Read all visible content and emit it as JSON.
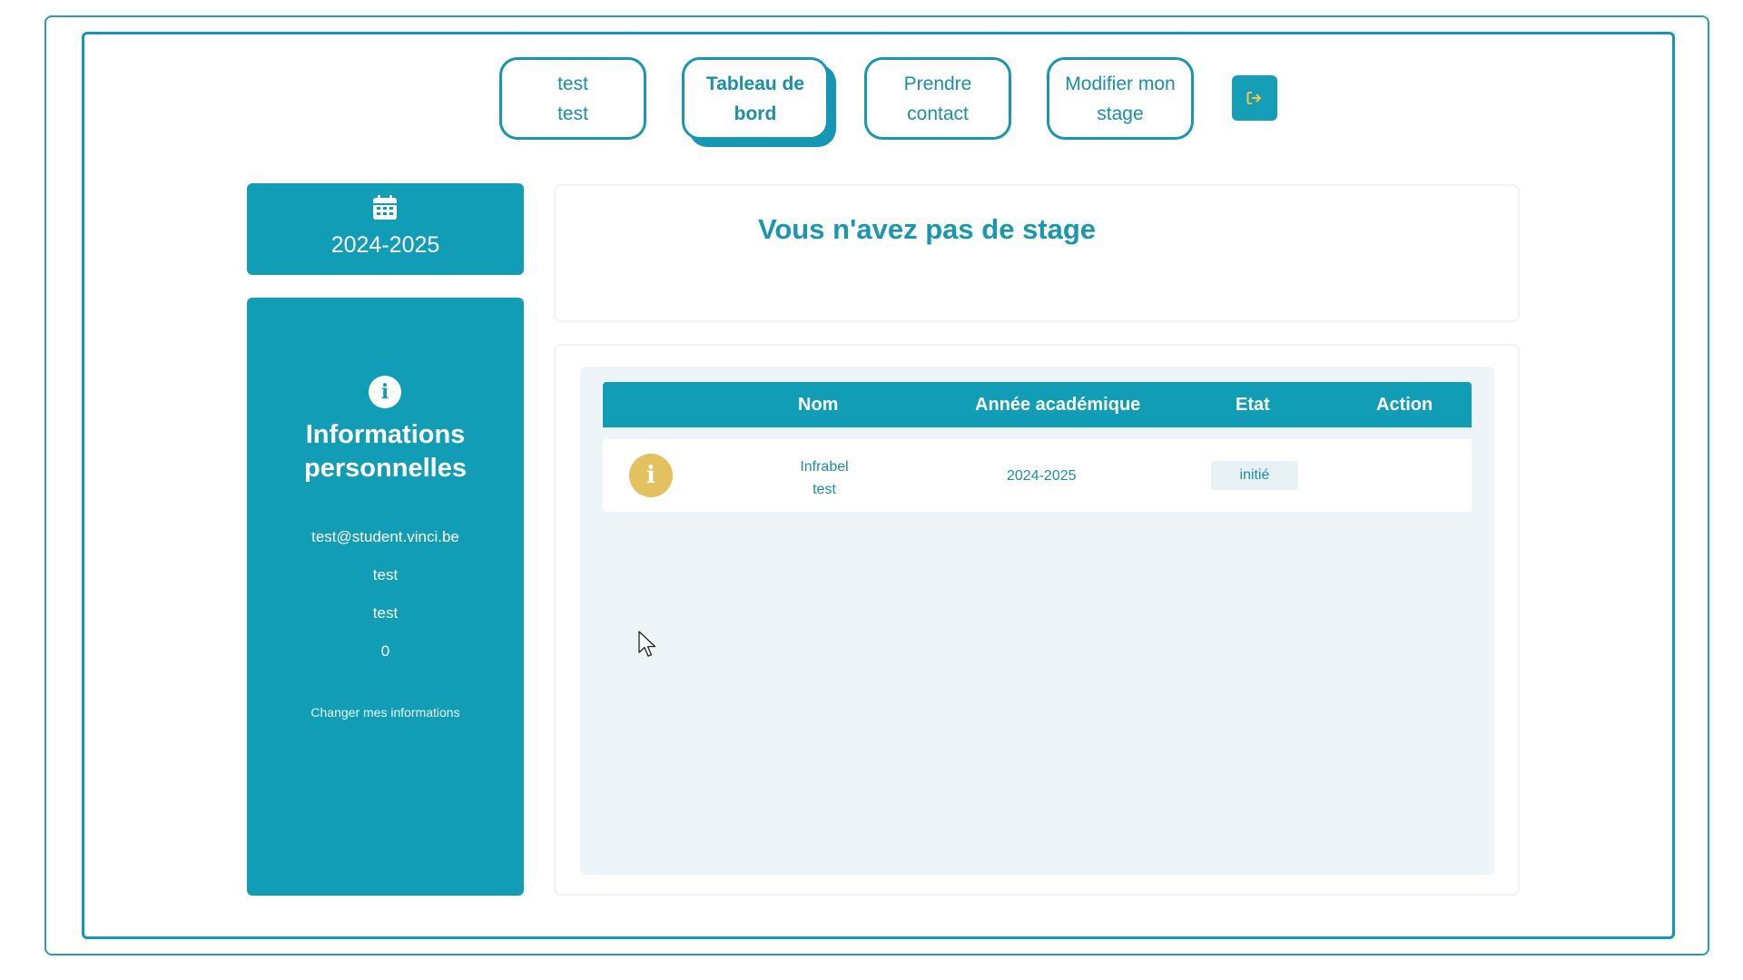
{
  "nav": {
    "profile": {
      "line1": "test",
      "line2": "test"
    },
    "dashboard": {
      "line1": "Tableau de",
      "line2": "bord"
    },
    "contact": {
      "line1": "Prendre",
      "line2": "contact"
    },
    "edit_internship": {
      "line1": "Modifier mon",
      "line2": "stage"
    },
    "logout_icon": "sign-out-icon",
    "active": "dashboard"
  },
  "sidebar": {
    "year_card": {
      "icon": "calendar-icon",
      "year": "2024-2025"
    },
    "info_card": {
      "icon": "info-icon",
      "title_line1": "Informations",
      "title_line2": "personnelles",
      "email": "test@student.vinci.be",
      "last_name": "test",
      "first_name": "test",
      "phone": "0",
      "change_link": "Changer mes informations"
    }
  },
  "main": {
    "status_message": "Vous n'avez pas de stage",
    "table": {
      "headers": [
        "Nom",
        "Année académique",
        "Etat",
        "Action"
      ],
      "rows": [
        {
          "icon": "info-icon",
          "name_line1": "Infrabel",
          "name_line2": "test",
          "academic_year": "2024-2025",
          "state": "initié",
          "action": ""
        }
      ]
    }
  },
  "colors": {
    "primary": "#129db7",
    "accent": "#e3c15f",
    "panel_bg": "#edf5f8",
    "logout_icon": "#f5c542"
  }
}
